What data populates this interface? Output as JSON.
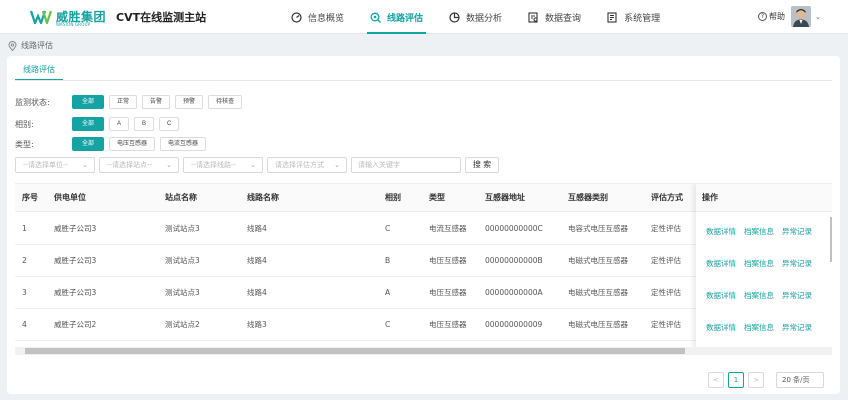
{
  "header": {
    "brand_cn": "威胜集团",
    "brand_en": "WASION GROUP",
    "system_title": "CVT在线监测主站",
    "nav": [
      {
        "label": "信息概览",
        "icon": "dashboard-icon",
        "active": false
      },
      {
        "label": "线路评估",
        "icon": "search-circle-icon",
        "active": true
      },
      {
        "label": "数据分析",
        "icon": "pie-chart-icon",
        "active": false
      },
      {
        "label": "数据查询",
        "icon": "document-search-icon",
        "active": false
      },
      {
        "label": "系统管理",
        "icon": "settings-doc-icon",
        "active": false
      }
    ],
    "help_label": "帮助",
    "accent": "#12a3a3"
  },
  "breadcrumb": "线路评估",
  "tab_label": "线路评估",
  "filters": {
    "status": {
      "label": "监测状态:",
      "options": [
        "全部",
        "正常",
        "告警",
        "预警",
        "待核查"
      ],
      "selected": "全部"
    },
    "phase": {
      "label": "相别:",
      "options": [
        "全部",
        "A",
        "B",
        "C"
      ],
      "selected": "全部"
    },
    "type": {
      "label": "类型:",
      "options": [
        "全部",
        "电压互感器",
        "电流互感器"
      ],
      "selected": "全部"
    }
  },
  "search": {
    "unit_placeholder": "--请选择单位--",
    "site_placeholder": "--请选择站点--",
    "line_placeholder": "--请选择线路--",
    "method_placeholder": "请选择评估方式",
    "keyword_placeholder": "请输入关键字",
    "button": "搜 索"
  },
  "table": {
    "columns": [
      "序号",
      "供电单位",
      "站点名称",
      "线路名称",
      "相别",
      "类型",
      "互感器地址",
      "互感器类别",
      "评估方式",
      "操作"
    ],
    "rows": [
      {
        "no": "1",
        "unit": "威胜子公司3",
        "site": "测试站点3",
        "line": "线路4",
        "phase": "C",
        "type": "电流互感器",
        "address": "00000000000C",
        "category": "电容式电压互感器",
        "method": "定性评估"
      },
      {
        "no": "2",
        "unit": "威胜子公司3",
        "site": "测试站点3",
        "line": "线路4",
        "phase": "B",
        "type": "电压互感器",
        "address": "00000000000B",
        "category": "电磁式电压互感器",
        "method": "定性评估"
      },
      {
        "no": "3",
        "unit": "威胜子公司3",
        "site": "测试站点3",
        "line": "线路4",
        "phase": "A",
        "type": "电压互感器",
        "address": "00000000000A",
        "category": "电磁式电压互感器",
        "method": "定性评估"
      },
      {
        "no": "4",
        "unit": "威胜子公司2",
        "site": "测试站点2",
        "line": "线路3",
        "phase": "C",
        "type": "电压互感器",
        "address": "000000000009",
        "category": "电磁式电压互感器",
        "method": "定性评估"
      }
    ],
    "actions": [
      "数据详情",
      "档案信息",
      "异常记录"
    ]
  },
  "pagination": {
    "prev": "<",
    "current": "1",
    "next": ">",
    "page_size": "20 条/页"
  }
}
